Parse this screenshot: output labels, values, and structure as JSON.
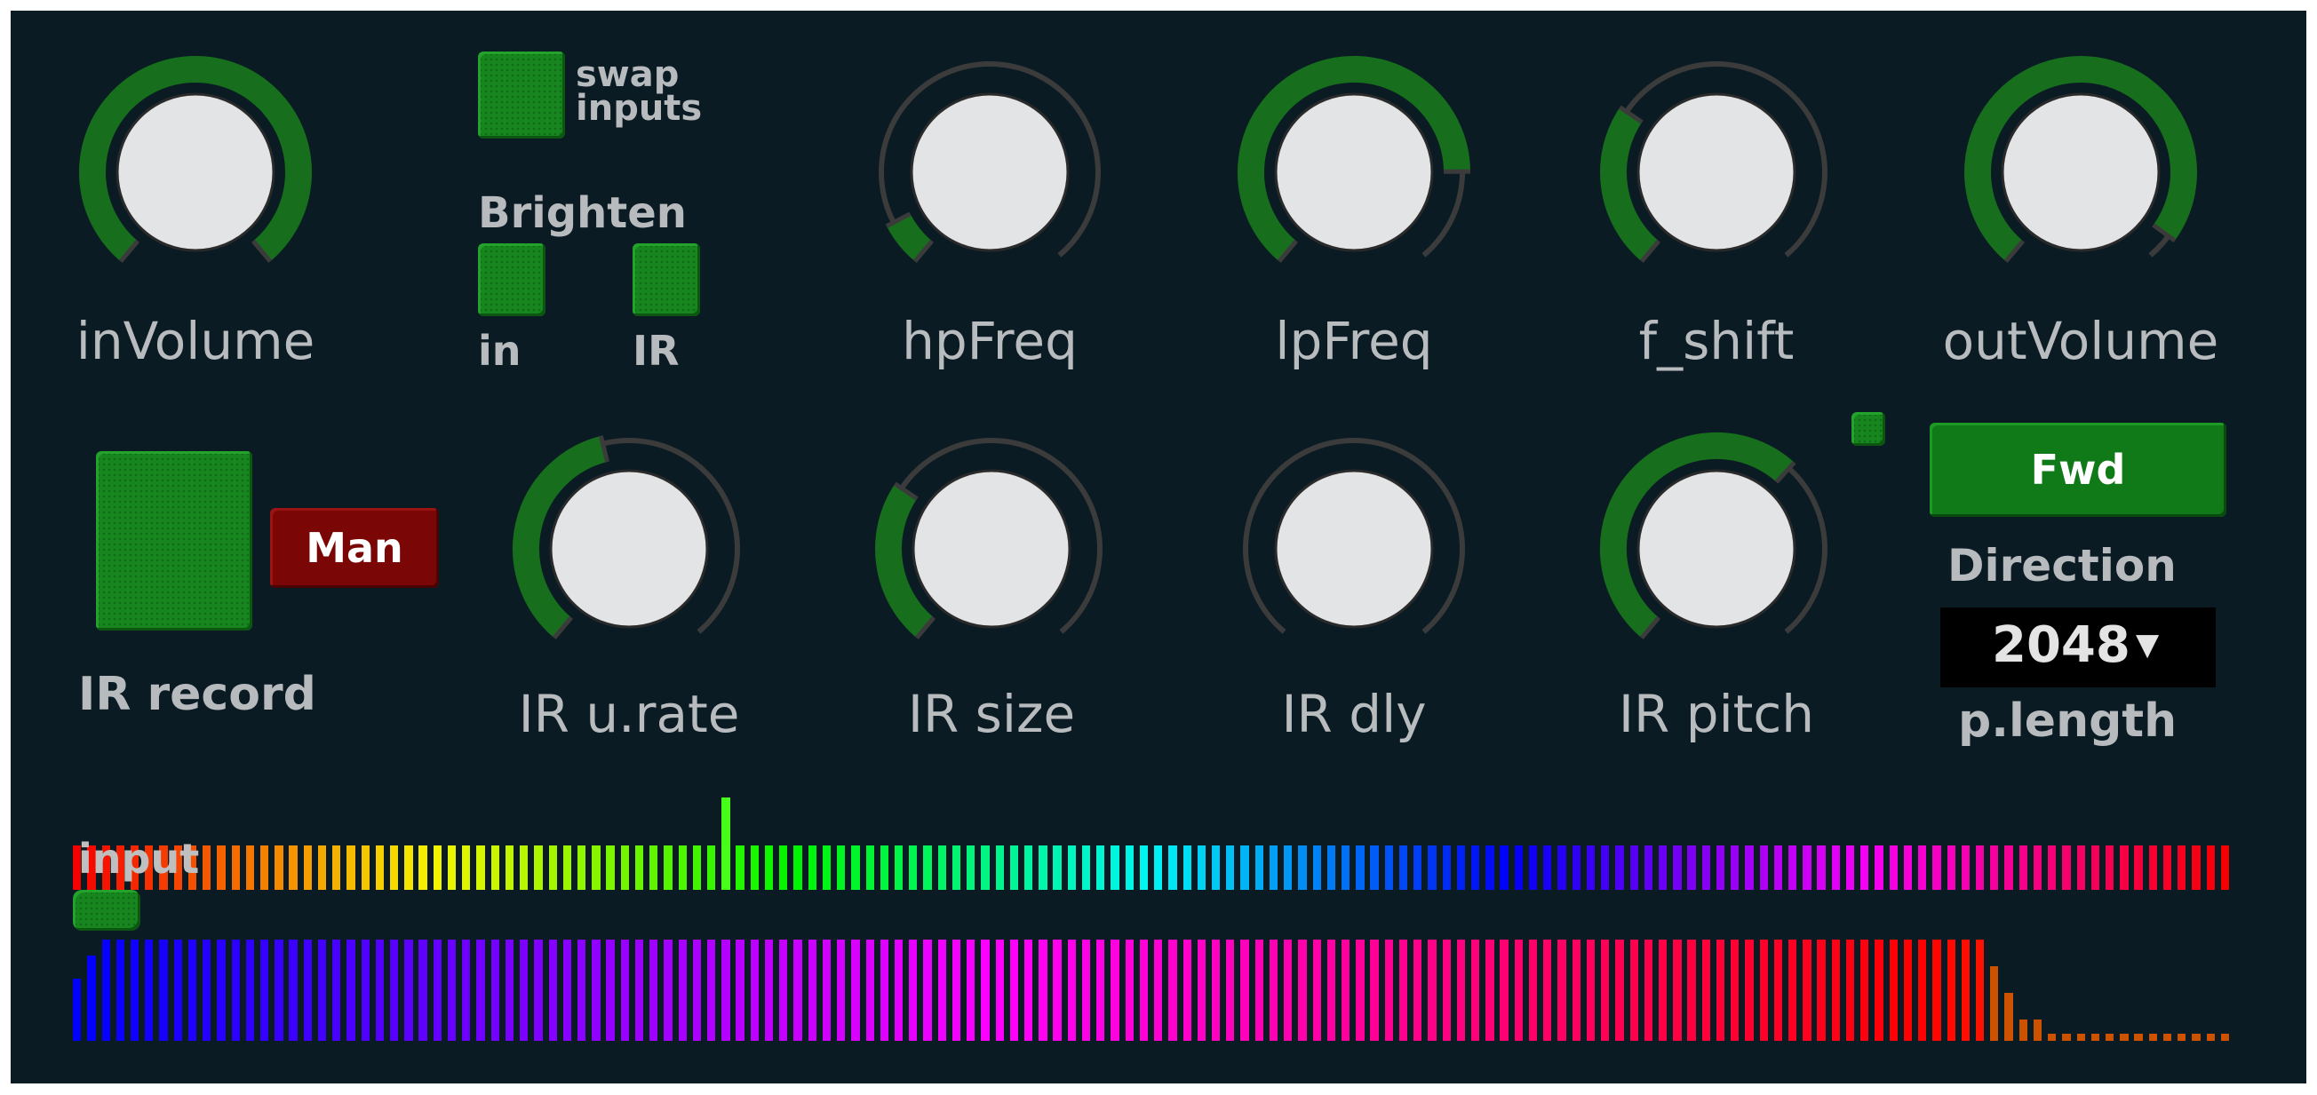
{
  "colors": {
    "panel_bg": "#0a1b24",
    "knob_track": "#3b3b3b",
    "knob_value": "#176e1d",
    "knob_cap": "#e2e4e6",
    "label": "#b9bcbf",
    "toggle_green": "#17861e",
    "man_red": "#7a0606"
  },
  "top_row": {
    "in_volume": {
      "label": "inVolume",
      "value": 1.0
    },
    "swap_inputs": {
      "label_line1": "swap",
      "label_line2": "inputs",
      "state": "on"
    },
    "brighten": {
      "title": "Brighten",
      "in_label": "in",
      "ir_label": "IR"
    },
    "hp_freq": {
      "label": "hpFreq",
      "value": 0.08
    },
    "lp_freq": {
      "label": "lpFreq",
      "value": 0.82
    },
    "f_shift": {
      "label": "f_shift",
      "value": 0.3
    },
    "out_volume": {
      "label": "outVolume",
      "value": 0.95
    }
  },
  "middle_row": {
    "ir_record": {
      "label": "IR record",
      "mode_button": "Man"
    },
    "ir_urate": {
      "label": "IR u.rate",
      "value": 0.45
    },
    "ir_size": {
      "label": "IR size",
      "value": 0.3
    },
    "ir_dly": {
      "label": "IR dly",
      "value": 0.0
    },
    "ir_pitch": {
      "label": "IR pitch",
      "value": 0.65
    },
    "direction": {
      "button": "Fwd",
      "label": "Direction"
    },
    "p_length": {
      "value": "2048",
      "arrow": "▼",
      "label": "p.length"
    }
  },
  "meters": {
    "input_label": "input",
    "input_bar_count": 150,
    "input_marker_index": 45,
    "ir_bar_count": 150,
    "ir_full_until": 132
  }
}
